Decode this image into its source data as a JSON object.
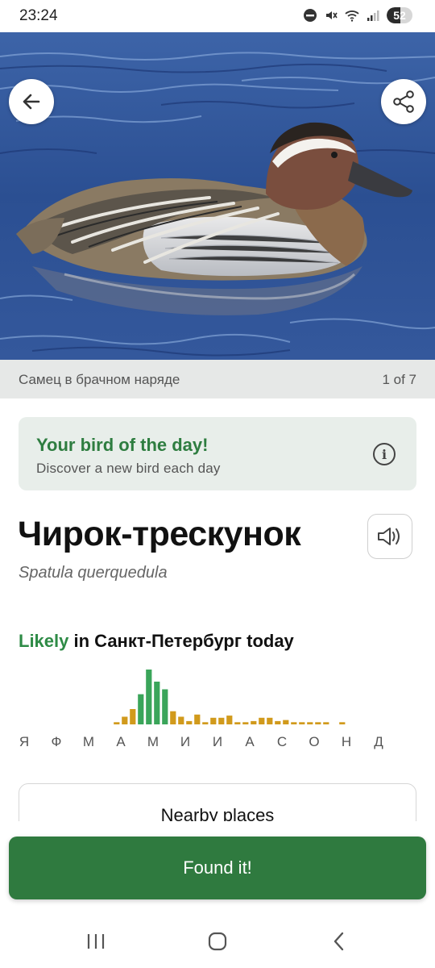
{
  "status_bar": {
    "time": "23:24",
    "battery": "52",
    "icons": [
      "do-not-disturb-icon",
      "mute-icon",
      "wifi-icon",
      "signal-icon",
      "battery-icon"
    ]
  },
  "hero": {
    "photo": "garganey-duck-photo",
    "back_icon": "arrow-left-icon",
    "share_icon": "share-icon"
  },
  "caption": {
    "text": "Самец в брачном наряде",
    "counter": "1 of 7"
  },
  "bird_of_day": {
    "title": "Your bird of the day!",
    "subtitle": "Discover a new bird each day",
    "info_icon": "info-icon"
  },
  "bird": {
    "name": "Чирок-трескунок",
    "scientific_name": "Spatula querquedula",
    "sound_icon": "speaker-icon"
  },
  "likelihood": {
    "status": "Likely",
    "rest": "in Санкт-Петербург today"
  },
  "chart_data": {
    "type": "bar",
    "months": [
      "Я",
      "Ф",
      "М",
      "А",
      "М",
      "И",
      "И",
      "А",
      "С",
      "О",
      "Н",
      "Д"
    ],
    "values": [
      0,
      0,
      0,
      0,
      0,
      0,
      0,
      0,
      0,
      0,
      0,
      0,
      0.04,
      0.14,
      0.28,
      0.55,
      1.0,
      0.78,
      0.64,
      0.24,
      0.14,
      0.06,
      0.18,
      0.04,
      0.12,
      0.12,
      0.16,
      0.04,
      0.04,
      0.06,
      0.12,
      0.12,
      0.06,
      0.08,
      0.04,
      0.04,
      0.04,
      0.04,
      0.04,
      0,
      0.04,
      0,
      0,
      0,
      0,
      0,
      0,
      0
    ],
    "likely_color": "#3aa55a",
    "possible_color": "#d19a1c",
    "likely_threshold": 0.5
  },
  "nearby": {
    "label": "Nearby places"
  },
  "found": {
    "label": "Found it!"
  },
  "colors": {
    "brand_green": "#2f7a3f",
    "card_bg": "#e8eeea"
  },
  "nav": {
    "recents_icon": "recents-icon",
    "home_icon": "home-icon",
    "back_icon": "nav-back-icon"
  }
}
